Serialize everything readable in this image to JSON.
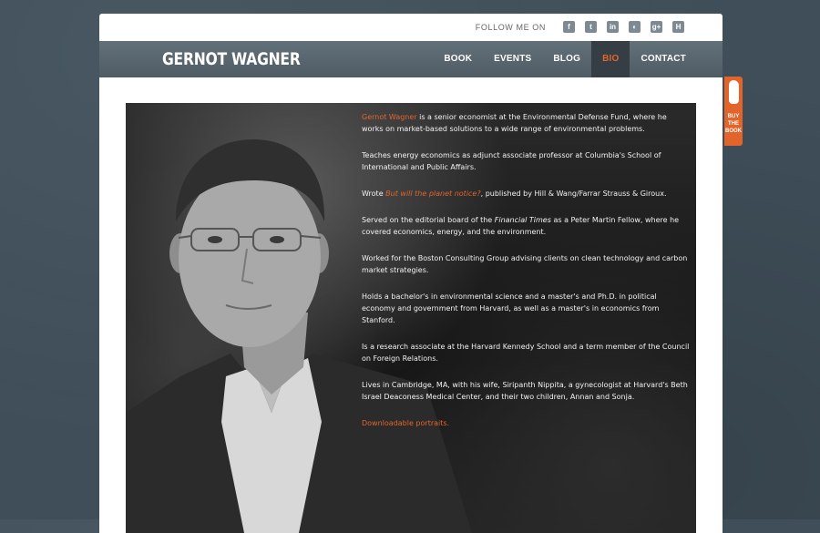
{
  "follow": {
    "label": "FOLLOW ME ON",
    "icons": [
      {
        "name": "facebook-icon",
        "glyph": "f"
      },
      {
        "name": "twitter-icon",
        "glyph": "t"
      },
      {
        "name": "linkedin-icon",
        "glyph": "in"
      },
      {
        "name": "rss-icon",
        "glyph": "◐"
      },
      {
        "name": "google-plus-icon",
        "glyph": "g+"
      },
      {
        "name": "huffington-icon",
        "glyph": "H"
      }
    ]
  },
  "logo": "GERNOT WAGNER",
  "nav": [
    "BOOK",
    "EVENTS",
    "BLOG",
    "BIO",
    "CONTACT"
  ],
  "bio": {
    "p1_link": "Gernot Wagner",
    "p1_rest": " is a senior economist at the Environmental Defense Fund, where he works on market-based solutions to a wide range of environmental problems.",
    "p2": "Teaches energy economics as adjunct associate professor at Columbia's School of International and Public Affairs.",
    "p3_pre": "Wrote ",
    "p3_book": "But will the planet notice?",
    "p3_post": ", published by Hill & Wang/Farrar Strauss & Giroux.",
    "p4_pre": "Served on the editorial board of the ",
    "p4_ft": "Financial Times",
    "p4_post": " as a Peter Martin Fellow, where he covered economics, energy, and the environment.",
    "p5": "Worked for the Boston Consulting Group advising clients on clean technology and carbon market strategies.",
    "p6": "Holds a bachelor's in environmental science and a master's and Ph.D. in political economy and government from Harvard, as well as a master's in economics from Stanford.",
    "p7": "Is a research associate at the Harvard Kennedy School and a term member of the Council on Foreign Relations.",
    "p8": "Lives in Cambridge, MA, with his wife, Siripanth Nippita, a gynecologist at Harvard's Beth Israel Deaconess Medical Center, and their two children, Annan and Sonja.",
    "downloads": "Downloadable portraits."
  },
  "buy_tab": {
    "line1": "BUY",
    "line2": "THE",
    "line3": "BOOK"
  },
  "colors": {
    "accent": "#e2642b",
    "navbar": "#55626b",
    "background": "#3f4e59"
  }
}
